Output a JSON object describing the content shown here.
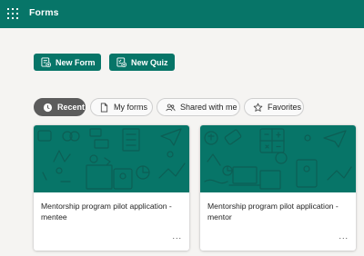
{
  "header": {
    "app_title": "Forms"
  },
  "actions": {
    "new_form_label": "New Form",
    "new_quiz_label": "New Quiz"
  },
  "filters": [
    {
      "label": "Recent",
      "icon": "clock-icon",
      "active": true
    },
    {
      "label": "My forms",
      "icon": "document-icon",
      "active": false
    },
    {
      "label": "Shared with me",
      "icon": "people-icon",
      "active": false
    },
    {
      "label": "Favorites",
      "icon": "star-icon",
      "active": false
    }
  ],
  "forms": [
    {
      "title": "Mentorship program pilot application - mentee",
      "more_label": "..."
    },
    {
      "title": "Mentorship program pilot application - mentor",
      "more_label": "..."
    }
  ],
  "colors": {
    "brand": "#077568",
    "active_pill": "#5c5c5c",
    "background": "#f5f4f2"
  }
}
